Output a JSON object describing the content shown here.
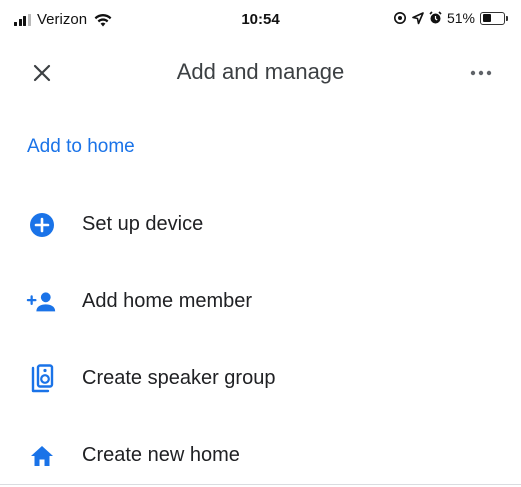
{
  "status_bar": {
    "carrier": "Verizon",
    "time": "10:54",
    "battery_percent": "51%",
    "battery_level": 0.51,
    "icons": [
      "signal-icon",
      "wifi-icon",
      "location-lock-icon",
      "location-arrow-icon",
      "alarm-icon",
      "battery-icon"
    ]
  },
  "app_bar": {
    "title": "Add and manage",
    "close_icon": "close-icon",
    "more_icon": "more-horizontal-icon"
  },
  "section": {
    "title": "Add to home"
  },
  "menu_items": [
    {
      "label": "Set up device",
      "icon": "add-circle-icon"
    },
    {
      "label": "Add home member",
      "icon": "person-add-icon"
    },
    {
      "label": "Create speaker group",
      "icon": "speaker-group-icon"
    },
    {
      "label": "Create new home",
      "icon": "home-icon"
    }
  ],
  "colors": {
    "accent": "#1a73e8",
    "text_primary": "#202124",
    "title_text": "#3c4043"
  }
}
